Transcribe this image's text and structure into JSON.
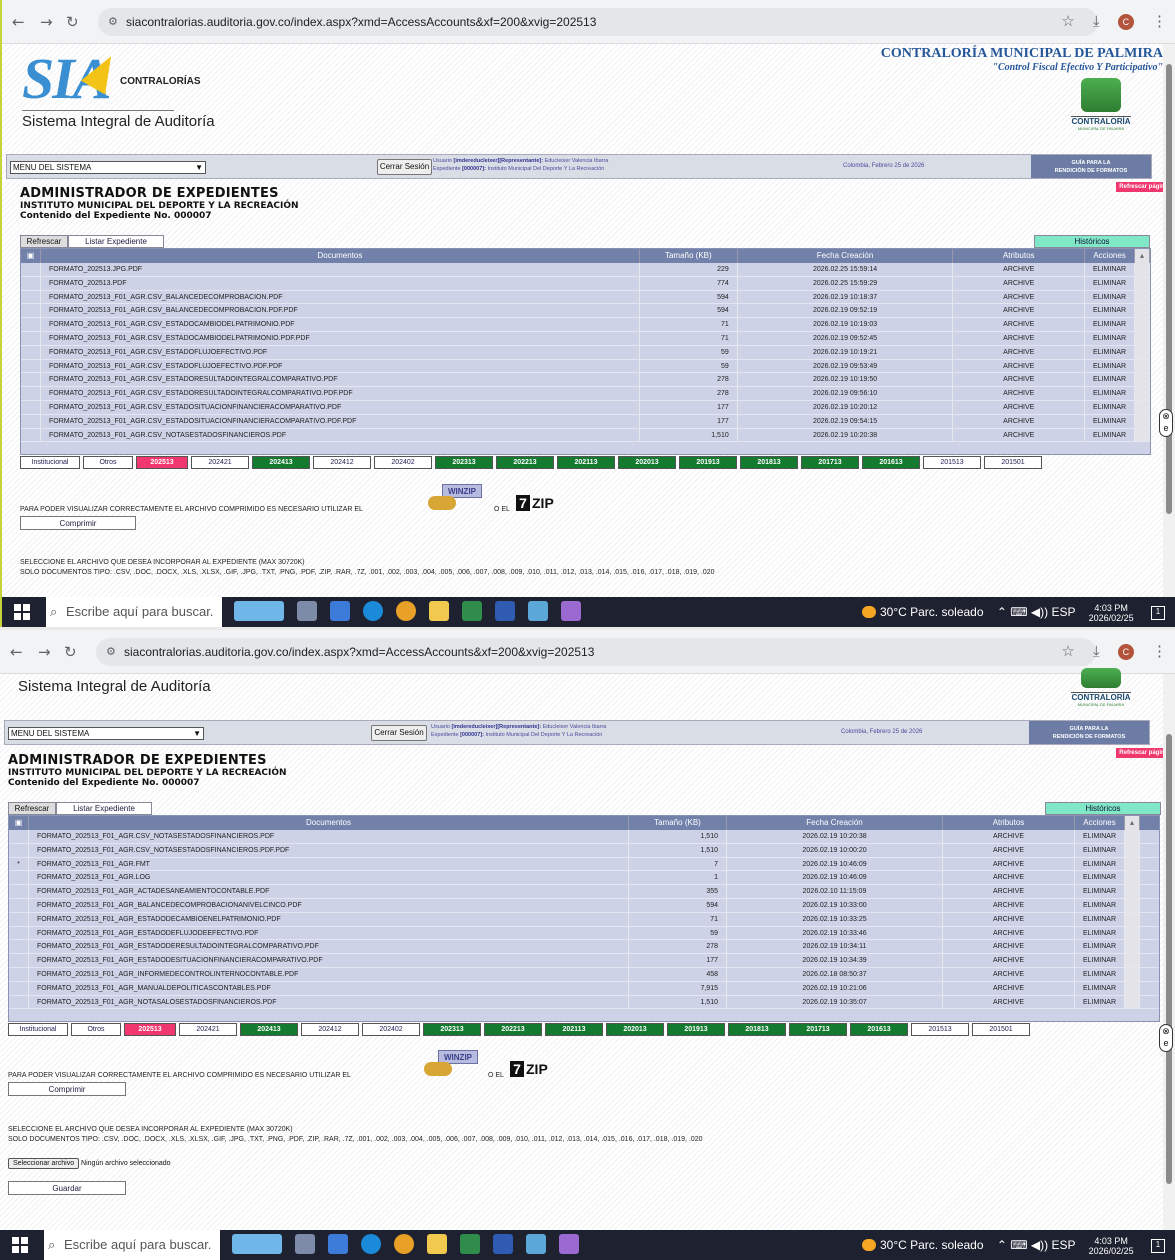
{
  "browser": {
    "url": "siacontralorias.auditoria.gov.co/index.aspx?xmd=AccessAccounts&xf=200&xvig=202513",
    "profile_initial": "C",
    "icons": [
      "back-icon",
      "forward-icon",
      "reload-icon",
      "site-settings-icon",
      "star-icon",
      "download-icon",
      "menu-icon"
    ]
  },
  "taskbar": {
    "search_placeholder": "Escribe aquí para buscar.",
    "weather": "30°C Parc. soleado",
    "lang": "ESP",
    "time": "4:03 PM",
    "date": "2026/02/25",
    "colors": {
      "bar": "#1e2230"
    }
  },
  "header": {
    "logo_text": "SIA",
    "logo_sub": "CONTRALORÍAS",
    "system_name": "Sistema Integral de Auditoría",
    "entity": "CONTRALORÍA MUNICIPAL DE PALMIRA",
    "slogan": "\"Control Fiscal Efectivo Y Participativo\"",
    "seal_label": "CONTRALORÍA",
    "seal_sub": "MUNICIPAL DE PALMIRA"
  },
  "menubar": {
    "menu_select": "MENU DEL SISTEMA",
    "logout": "Cerrar Sesión",
    "user_prefix": "Usuario",
    "user_id": "[imdereducleixer][Representante]:",
    "user_name": "Educleixer Valencia Ibarra",
    "exp_prefix": "Expediente",
    "exp_id": "[000007]:",
    "exp_name": "Instituto Municipal Del Deporte Y La Recreación",
    "date": "Colombia, Febrero 25 de 2026",
    "guide_line1": "GUÍA PARA LA",
    "guide_line2": "RENDICIÓN DE FORMATOS",
    "refresh_page": "Refrescar página"
  },
  "title": {
    "h1": "ADMINISTRADOR DE EXPEDIENTES",
    "h2": "INSTITUTO MUNICIPAL DEL DEPORTE Y LA RECREACIÓN",
    "h3": "Contenido del Expediente No. 000007"
  },
  "toolbar": {
    "refresh": "Refrescar",
    "list": "Listar Expediente",
    "historicos": "Históricos"
  },
  "table": {
    "columns": [
      "Documentos",
      "Tamaño (KB)",
      "Fecha Creación",
      "Atributos",
      "Acciones"
    ],
    "rows_view1": [
      {
        "mark": "",
        "doc": "FORMATO_202513.JPG.PDF",
        "size": "229",
        "date": "2026.02.25 15:59:14",
        "attr": "ARCHIVE",
        "action": "ELIMINAR"
      },
      {
        "mark": "",
        "doc": "FORMATO_202513.PDF",
        "size": "774",
        "date": "2026.02.25 15:59:29",
        "attr": "ARCHIVE",
        "action": "ELIMINAR"
      },
      {
        "mark": "",
        "doc": "FORMATO_202513_F01_AGR.CSV_BALANCEDECOMPROBACION.PDF",
        "size": "594",
        "date": "2026.02.19 10:18:37",
        "attr": "ARCHIVE",
        "action": "ELIMINAR"
      },
      {
        "mark": "",
        "doc": "FORMATO_202513_F01_AGR.CSV_BALANCEDECOMPROBACION.PDF.PDF",
        "size": "594",
        "date": "2026.02.19 09:52:19",
        "attr": "ARCHIVE",
        "action": "ELIMINAR"
      },
      {
        "mark": "",
        "doc": "FORMATO_202513_F01_AGR.CSV_ESTADOCAMBIODELPATRIMONIO.PDF",
        "size": "71",
        "date": "2026.02.19 10:19:03",
        "attr": "ARCHIVE",
        "action": "ELIMINAR"
      },
      {
        "mark": "",
        "doc": "FORMATO_202513_F01_AGR.CSV_ESTADOCAMBIODELPATRIMONIO.PDF.PDF",
        "size": "71",
        "date": "2026.02.19 09:52:45",
        "attr": "ARCHIVE",
        "action": "ELIMINAR"
      },
      {
        "mark": "",
        "doc": "FORMATO_202513_F01_AGR.CSV_ESTADOFLUJOEFECTIVO.PDF",
        "size": "59",
        "date": "2026.02.19 10:19:21",
        "attr": "ARCHIVE",
        "action": "ELIMINAR"
      },
      {
        "mark": "",
        "doc": "FORMATO_202513_F01_AGR.CSV_ESTADOFLUJOEFECTIVO.PDF.PDF",
        "size": "59",
        "date": "2026.02.19 09:53:49",
        "attr": "ARCHIVE",
        "action": "ELIMINAR"
      },
      {
        "mark": "",
        "doc": "FORMATO_202513_F01_AGR.CSV_ESTADORESULTADOINTEGRALCOMPARATIVO.PDF",
        "size": "278",
        "date": "2026.02.19 10:19:50",
        "attr": "ARCHIVE",
        "action": "ELIMINAR"
      },
      {
        "mark": "",
        "doc": "FORMATO_202513_F01_AGR.CSV_ESTADORESULTADOINTEGRALCOMPARATIVO.PDF.PDF",
        "size": "278",
        "date": "2026.02.19 09:56:10",
        "attr": "ARCHIVE",
        "action": "ELIMINAR"
      },
      {
        "mark": "",
        "doc": "FORMATO_202513_F01_AGR.CSV_ESTADOSITUACIONFINANCIERACOMPARATIVO.PDF",
        "size": "177",
        "date": "2026.02.19 10:20:12",
        "attr": "ARCHIVE",
        "action": "ELIMINAR"
      },
      {
        "mark": "",
        "doc": "FORMATO_202513_F01_AGR.CSV_ESTADOSITUACIONFINANCIERACOMPARATIVO.PDF.PDF",
        "size": "177",
        "date": "2026.02.19 09:54:15",
        "attr": "ARCHIVE",
        "action": "ELIMINAR"
      },
      {
        "mark": "",
        "doc": "FORMATO_202513_F01_AGR.CSV_NOTASESTADOSFINANCIEROS.PDF",
        "size": "1,510",
        "date": "2026.02.19 10:20:38",
        "attr": "ARCHIVE",
        "action": "ELIMINAR"
      }
    ],
    "rows_view2": [
      {
        "mark": "",
        "doc": "FORMATO_202513_F01_AGR.CSV_NOTASESTADOSFINANCIEROS.PDF",
        "size": "1,510",
        "date": "2026.02.19 10:20:38",
        "attr": "ARCHIVE",
        "action": "ELIMINAR"
      },
      {
        "mark": "",
        "doc": "FORMATO_202513_F01_AGR.CSV_NOTASESTADOSFINANCIEROS.PDF.PDF",
        "size": "1,510",
        "date": "2026.02.19 10:00:20",
        "attr": "ARCHIVE",
        "action": "ELIMINAR"
      },
      {
        "mark": "*",
        "doc": "FORMATO_202513_F01_AGR.FMT",
        "size": "7",
        "date": "2026.02.19 10:46:09",
        "attr": "ARCHIVE",
        "action": "ELIMINAR"
      },
      {
        "mark": "",
        "doc": "FORMATO_202513_F01_AGR.LOG",
        "size": "1",
        "date": "2026.02.19 10:46:09",
        "attr": "ARCHIVE",
        "action": "ELIMINAR"
      },
      {
        "mark": "",
        "doc": "FORMATO_202513_F01_AGR_ACTADESANEAMIENTOCONTABLE.PDF",
        "size": "355",
        "date": "2026.02.10 11:15:09",
        "attr": "ARCHIVE",
        "action": "ELIMINAR"
      },
      {
        "mark": "",
        "doc": "FORMATO_202513_F01_AGR_BALANCEDECOMPROBACIONANIVELCINCO.PDF",
        "size": "594",
        "date": "2026.02.19 10:33:00",
        "attr": "ARCHIVE",
        "action": "ELIMINAR"
      },
      {
        "mark": "",
        "doc": "FORMATO_202513_F01_AGR_ESTADODECAMBIOENELPATRIMONIO.PDF",
        "size": "71",
        "date": "2026.02.19 10:33:25",
        "attr": "ARCHIVE",
        "action": "ELIMINAR"
      },
      {
        "mark": "",
        "doc": "FORMATO_202513_F01_AGR_ESTADODEFLUJODEEFECTIVO.PDF",
        "size": "59",
        "date": "2026.02.19 10:33:46",
        "attr": "ARCHIVE",
        "action": "ELIMINAR"
      },
      {
        "mark": "",
        "doc": "FORMATO_202513_F01_AGR_ESTADODERESULTADOINTEGRALCOMPARATIVO.PDF",
        "size": "278",
        "date": "2026.02.19 10:34:11",
        "attr": "ARCHIVE",
        "action": "ELIMINAR"
      },
      {
        "mark": "",
        "doc": "FORMATO_202513_F01_AGR_ESTADODESITUACIONFINANCIERACOMPARATIVO.PDF",
        "size": "177",
        "date": "2026.02.19 10:34:39",
        "attr": "ARCHIVE",
        "action": "ELIMINAR"
      },
      {
        "mark": "",
        "doc": "FORMATO_202513_F01_AGR_INFORMEDECONTROLINTERNOCONTABLE.PDF",
        "size": "458",
        "date": "2026.02.18 08:50:37",
        "attr": "ARCHIVE",
        "action": "ELIMINAR"
      },
      {
        "mark": "",
        "doc": "FORMATO_202513_F01_AGR_MANUALDEPOLITICASCONTABLES.PDF",
        "size": "7,915",
        "date": "2026.02.19 10:21:06",
        "attr": "ARCHIVE",
        "action": "ELIMINAR"
      },
      {
        "mark": "",
        "doc": "FORMATO_202513_F01_AGR_NOTASALOSESTADOSFINANCIEROS.PDF",
        "size": "1,510",
        "date": "2026.02.19 10:35:07",
        "attr": "ARCHIVE",
        "action": "ELIMINAR"
      }
    ]
  },
  "pager": [
    {
      "label": "Institucional",
      "style": "w",
      "w": 60
    },
    {
      "label": "Otros",
      "style": "w",
      "w": 50
    },
    {
      "label": "202513",
      "style": "p",
      "w": 52
    },
    {
      "label": "202421",
      "style": "w",
      "w": 58
    },
    {
      "label": "202413",
      "style": "g",
      "w": 58
    },
    {
      "label": "202412",
      "style": "w",
      "w": 58
    },
    {
      "label": "202402",
      "style": "w",
      "w": 58
    },
    {
      "label": "202313",
      "style": "g",
      "w": 58
    },
    {
      "label": "202213",
      "style": "g",
      "w": 58
    },
    {
      "label": "202113",
      "style": "g",
      "w": 58
    },
    {
      "label": "202013",
      "style": "g",
      "w": 58
    },
    {
      "label": "201913",
      "style": "g",
      "w": 58
    },
    {
      "label": "201813",
      "style": "g",
      "w": 58
    },
    {
      "label": "201713",
      "style": "g",
      "w": 58
    },
    {
      "label": "201613",
      "style": "g",
      "w": 58
    },
    {
      "label": "201513",
      "style": "w",
      "w": 58
    },
    {
      "label": "201501",
      "style": "w",
      "w": 58
    }
  ],
  "compress": {
    "notice": "PARA PODER VISUALIZAR CORRECTAMENTE EL ARCHIVO COMPRIMIDO ES NECESARIO UTILIZAR EL",
    "or": "O EL",
    "winzip": "WINZIP",
    "zip7_num": "7",
    "zip7_txt": "ZIP",
    "button": "Comprimir"
  },
  "upload": {
    "line1": "SELECCIONE EL ARCHIVO QUE DESEA INCORPORAR AL EXPEDIENTE (MAX 30720K)",
    "line2": "SOLO DOCUMENTOS TIPO: .CSV, .DOC, .DOCX, .XLS, .XLSX, .GIF, .JPG, .TXT, .PNG, .PDF, .ZIP, .RAR, .7Z, .001, .002, .003, .004, .005, .006, .007, .008, .009, .010, .011, .012, .013, .014, .015, .016, .017, .018, .019, .020",
    "choose": "Seleccionar archivo",
    "no_file": "Ningún archivo seleccionado",
    "save": "Guardar"
  }
}
